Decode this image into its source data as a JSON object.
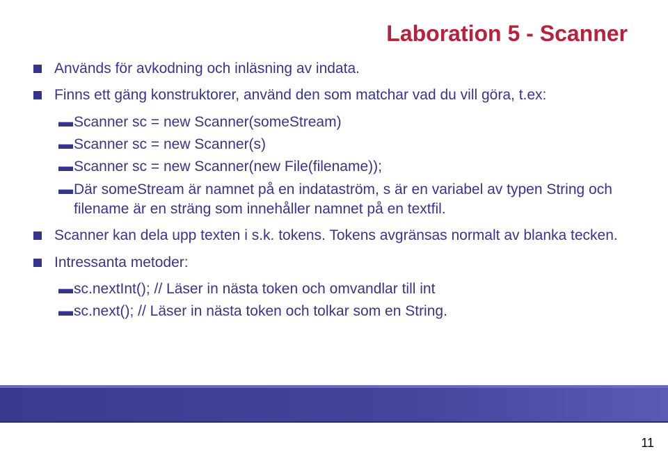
{
  "title": "Laboration 5 - Scanner",
  "bullets": {
    "b1": "Används för avkodning och inläsning av indata.",
    "b2": "Finns ett gäng konstruktorer, använd den som matchar vad du vill göra, t.ex:",
    "b3": "Scanner kan dela upp texten i s.k. tokens. Tokens avgränsas normalt av blanka tecken.",
    "b4": "Intressanta metoder:"
  },
  "sub1": {
    "s1": "Scanner sc = new Scanner(someStream)",
    "s2": "Scanner sc = new Scanner(s)",
    "s3": "Scanner sc = new Scanner(new File(filename));",
    "s4": "Där someStream är namnet på en indataström, s är en variabel av typen String och filename är en sträng som innehåller namnet på en textfil."
  },
  "sub2": {
    "s1": "sc.nextInt(); // Läser in nästa token och omvandlar till int",
    "s2": "sc.next(); // Läser in nästa token och tolkar som en String."
  },
  "pageNumber": "11"
}
